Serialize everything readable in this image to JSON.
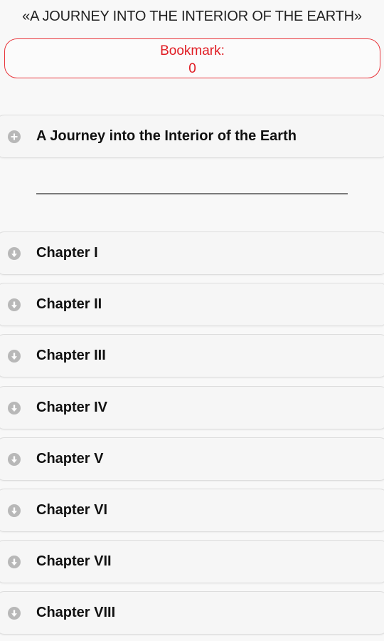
{
  "app_title": "«A JOURNEY INTO THE INTERIOR OF THE EARTH»",
  "bookmark": {
    "label": "Bookmark:",
    "value": "0",
    "color": "#e01b22"
  },
  "book_row": {
    "label": "A Journey into the Interior of the Earth",
    "icon": "plus-circle-icon"
  },
  "chapters": [
    {
      "label": "Chapter I",
      "icon": "arrow-down-circle-icon"
    },
    {
      "label": "Chapter II",
      "icon": "arrow-down-circle-icon"
    },
    {
      "label": "Chapter III",
      "icon": "arrow-down-circle-icon"
    },
    {
      "label": "Chapter IV",
      "icon": "arrow-down-circle-icon"
    },
    {
      "label": "Chapter V",
      "icon": "arrow-down-circle-icon"
    },
    {
      "label": "Chapter VI",
      "icon": "arrow-down-circle-icon"
    },
    {
      "label": "Chapter VII",
      "icon": "arrow-down-circle-icon"
    },
    {
      "label": "Chapter VIII",
      "icon": "arrow-down-circle-icon"
    }
  ]
}
